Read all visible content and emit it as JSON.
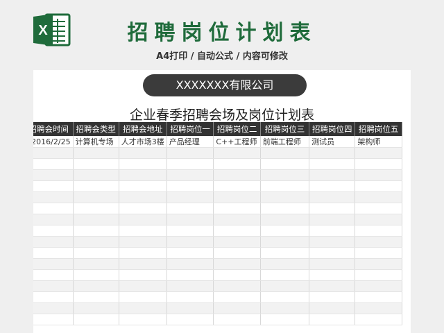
{
  "header": {
    "title": "招聘岗位计划表",
    "subtitle": "A4打印 / 自动公式 / 内容可修改",
    "logo_letter": "X",
    "accent_color": "#1f6b3b"
  },
  "sheet": {
    "company": "XXXXXXX有限公司",
    "title": "企业春季招聘会场及岗位计划表",
    "columns": [
      "招聘会时间",
      "招聘会类型",
      "招聘会地址",
      "招聘岗位一",
      "招聘岗位二",
      "招聘岗位三",
      "招聘岗位四",
      "招聘岗位五"
    ],
    "rows": [
      [
        "2016/2/25",
        "计算机专场",
        "人才市场3楼",
        "产品经理",
        "C++工程师",
        "前端工程师",
        "测试员",
        "架构师"
      ]
    ]
  }
}
